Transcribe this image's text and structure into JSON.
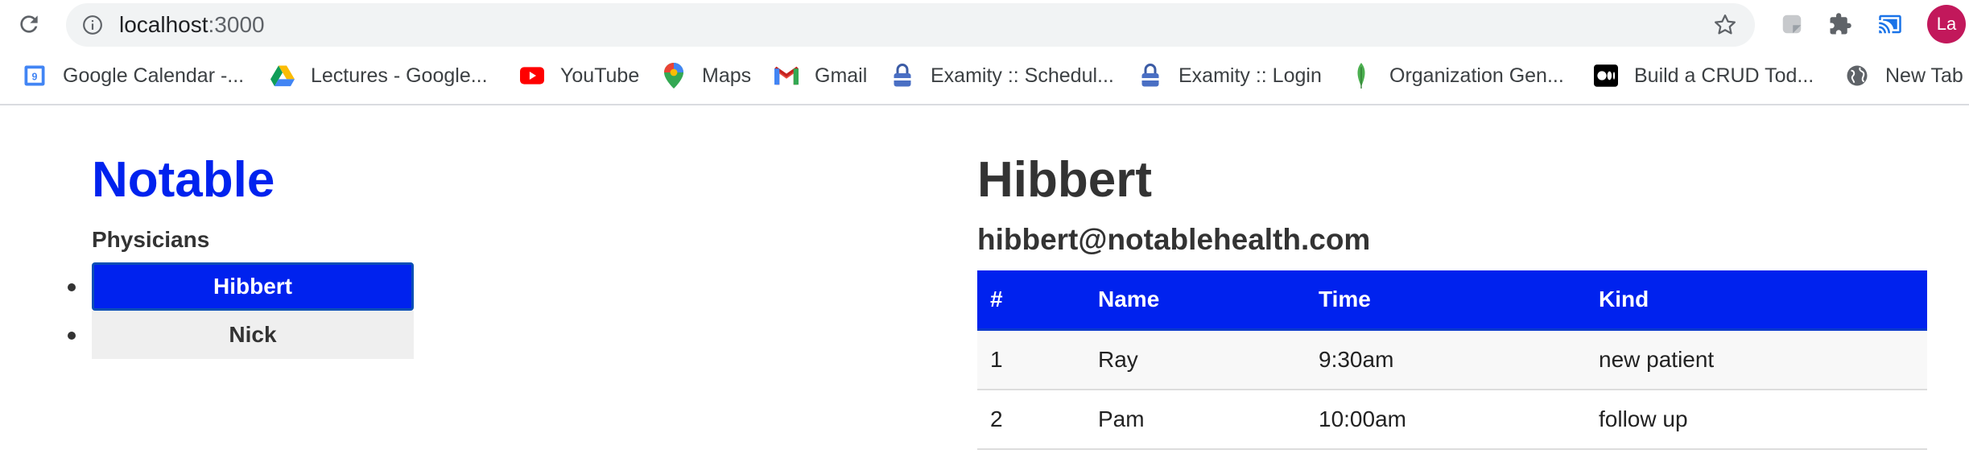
{
  "browser": {
    "url_host": "localhost",
    "url_port": ":3000",
    "avatar_initials": "La",
    "bookmarks": [
      {
        "label": "Google Calendar -...",
        "icon": "google-calendar-icon"
      },
      {
        "label": "Lectures - Google...",
        "icon": "google-drive-icon"
      },
      {
        "label": "YouTube",
        "icon": "youtube-icon"
      },
      {
        "label": "Maps",
        "icon": "maps-pin-icon"
      },
      {
        "label": "Gmail",
        "icon": "gmail-icon"
      },
      {
        "label": "Examity :: Schedul...",
        "icon": "lock-icon"
      },
      {
        "label": "Examity :: Login",
        "icon": "lock-icon"
      },
      {
        "label": "Organization Gen...",
        "icon": "leaf-icon"
      },
      {
        "label": "Build a CRUD Tod...",
        "icon": "medium-icon"
      },
      {
        "label": "New Tab",
        "icon": "globe-icon"
      }
    ]
  },
  "app": {
    "brand": "Notable",
    "physicians_heading": "Physicians",
    "physicians": [
      {
        "name": "Hibbert",
        "active": true
      },
      {
        "name": "Nick",
        "active": false
      }
    ]
  },
  "detail": {
    "name": "Hibbert",
    "email": "hibbert@notablehealth.com",
    "columns": [
      "#",
      "Name",
      "Time",
      "Kind"
    ],
    "rows": [
      [
        "1",
        "Ray",
        "9:30am",
        "new patient"
      ],
      [
        "2",
        "Pam",
        "10:00am",
        "follow up"
      ]
    ]
  },
  "colors": {
    "accent": "#0022ee",
    "active_border": "#0a4fb5",
    "avatar": "#c2185b"
  }
}
